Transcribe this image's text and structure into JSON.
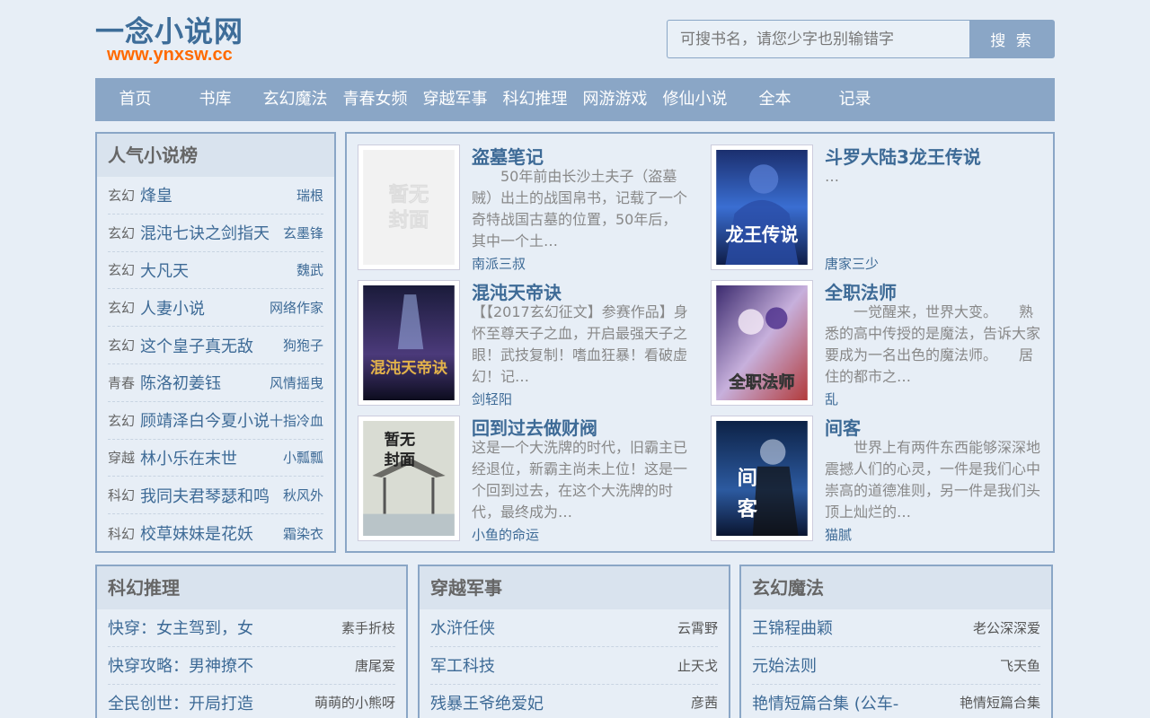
{
  "header": {
    "site_name": "一念小说网",
    "domain": "www.ynxsw.cc",
    "search_placeholder": "可搜书名，请您少字也别输错字",
    "search_button": "搜 索"
  },
  "nav": [
    "首页",
    "书库",
    "玄幻魔法",
    "青春女频",
    "穿越军事",
    "科幻推理",
    "网游游戏",
    "修仙小说",
    "全本",
    "记录"
  ],
  "ranking": {
    "title": "人气小说榜",
    "items": [
      {
        "cat": "玄幻",
        "title": "烽皇",
        "author": "瑞根"
      },
      {
        "cat": "玄幻",
        "title": "混沌七诀之剑指天",
        "author": "玄墨锋"
      },
      {
        "cat": "玄幻",
        "title": "大凡天",
        "author": "魏武"
      },
      {
        "cat": "玄幻",
        "title": "人妻小说",
        "author": "网络作家"
      },
      {
        "cat": "玄幻",
        "title": "这个皇子真无敌",
        "author": "狗狍子"
      },
      {
        "cat": "青春",
        "title": "陈洛初姜钰",
        "author": "风情摇曳"
      },
      {
        "cat": "玄幻",
        "title": "顾靖泽白今夏小说",
        "author": "十指冷血"
      },
      {
        "cat": "穿越",
        "title": "林小乐在末世",
        "author": "小瓢瓢"
      },
      {
        "cat": "科幻",
        "title": "我同夫君琴瑟和鸣",
        "author": "秋风外"
      },
      {
        "cat": "科幻",
        "title": "校草妹妹是花妖",
        "author": "霜染衣"
      }
    ]
  },
  "featured": [
    {
      "title": "盗墓笔记",
      "desc": "　　50年前由长沙土夫子（盗墓贼）出土的战国帛书，记载了一个奇特战国古墓的位置，50年后，其中一个土…",
      "author": "南派三叔",
      "cover": "placeholder",
      "cover_text": "暂无封面"
    },
    {
      "title": "斗罗大陆3龙王传说",
      "desc": "…",
      "author": "唐家三少",
      "cover": "blue",
      "cover_text": "龙王传说"
    },
    {
      "title": "混沌天帝诀",
      "desc": "【【2017玄幻征文】参赛作品】身怀至尊天子之血，开启最强天子之眼！武技复制！嗜血狂暴！看破虚幻！记…",
      "author": "剑轻阳",
      "cover": "dark",
      "cover_text": "混沌天帝诀"
    },
    {
      "title": "全职法师",
      "desc": "　　一觉醒来，世界大变。　　熟悉的高中传授的是魔法，告诉大家要成为一名出色的魔法师。　　居住的都市之…",
      "author": "乱",
      "cover": "purple",
      "cover_text": "全职法师"
    },
    {
      "title": "回到过去做财阀",
      "desc": "这是一个大洗牌的时代，旧霸主已经退位，新霸主尚未上位！这是一个回到过去，在这个大洗牌的时代，最终成为…",
      "author": "小鱼的命运",
      "cover": "landscape",
      "cover_text": "暂无封面"
    },
    {
      "title": "间客",
      "desc": "　　世界上有两件东西能够深深地震撼人们的心灵，一件是我们心中崇高的道德准则，另一件是我们头顶上灿烂的…",
      "author": "猫腻",
      "cover": "night",
      "cover_text": "间客"
    }
  ],
  "categories": [
    {
      "title": "科幻推理",
      "items": [
        {
          "title": "快穿：女主驾到，女",
          "author": "素手折枝"
        },
        {
          "title": "快穿攻略：男神撩不",
          "author": "唐尾爱"
        },
        {
          "title": "全民创世：开局打造",
          "author": "萌萌的小熊呀"
        }
      ]
    },
    {
      "title": "穿越军事",
      "items": [
        {
          "title": "水浒任侠",
          "author": "云霄野"
        },
        {
          "title": "军工科技",
          "author": "止天戈"
        },
        {
          "title": "残暴王爷绝爱妃",
          "author": "彦茜"
        }
      ]
    },
    {
      "title": "玄幻魔法",
      "items": [
        {
          "title": "王锦程曲颖",
          "author": "老公深深爱"
        },
        {
          "title": "元始法则",
          "author": "飞天鱼"
        },
        {
          "title": "艳情短篇合集 (公车-",
          "author": "艳情短篇合集"
        }
      ]
    }
  ]
}
